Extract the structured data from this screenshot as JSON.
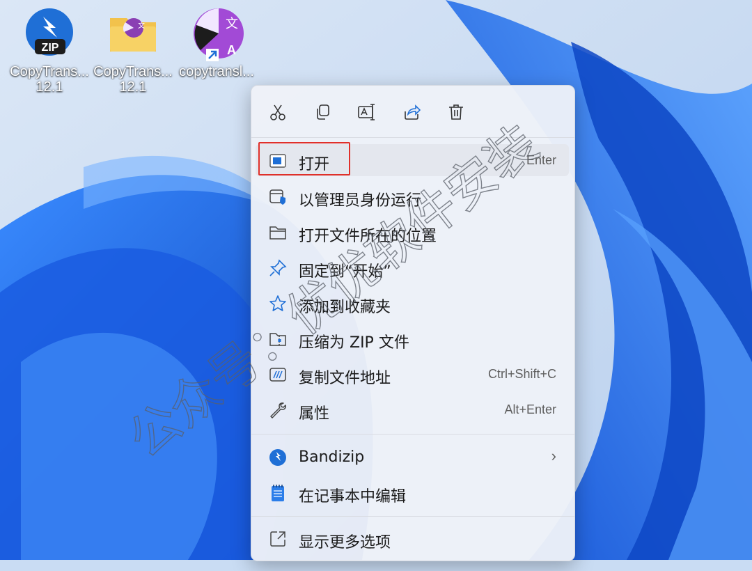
{
  "desktop": {
    "icons": [
      {
        "name": "CopyTrans...",
        "subtitle": "12.1",
        "type": "zip"
      },
      {
        "name": "CopyTrans...",
        "subtitle": "12.1",
        "type": "folder"
      },
      {
        "name": "copytransl...",
        "subtitle": "",
        "type": "shortcut"
      }
    ],
    "zip_badge": "ZIP",
    "translate_glyph": "文",
    "translate_letter": "A"
  },
  "context_menu": {
    "quick_actions": [
      {
        "icon": "cut-icon"
      },
      {
        "icon": "copy-icon"
      },
      {
        "icon": "rename-icon"
      },
      {
        "icon": "share-icon"
      },
      {
        "icon": "delete-icon"
      }
    ],
    "items": [
      {
        "label": "打开",
        "shortcut": "Enter",
        "icon": "open-app-icon"
      },
      {
        "label": "以管理员身份运行",
        "shortcut": "",
        "icon": "admin-shield-icon"
      },
      {
        "label": "打开文件所在的位置",
        "shortcut": "",
        "icon": "folder-icon"
      },
      {
        "label": "固定到“开始”",
        "shortcut": "",
        "icon": "pin-icon"
      },
      {
        "label": "添加到收藏夹",
        "shortcut": "",
        "icon": "star-icon"
      },
      {
        "label": "压缩为 ZIP 文件",
        "shortcut": "",
        "icon": "zip-folder-icon"
      },
      {
        "label": "复制文件地址",
        "shortcut": "Ctrl+Shift+C",
        "icon": "copy-path-icon"
      },
      {
        "label": "属性",
        "shortcut": "Alt+Enter",
        "icon": "wrench-icon"
      }
    ],
    "app_items": [
      {
        "label": "Bandizip",
        "icon": "bandizip-icon",
        "submenu": "›"
      },
      {
        "label": "在记事本中编辑",
        "icon": "notepad-icon"
      }
    ],
    "more_options": {
      "label": "显示更多选项",
      "icon": "more-options-icon"
    }
  },
  "watermark": "公众号：优优软件安装",
  "colors": {
    "accent_blue": "#1f6fd6",
    "highlight_red": "#e0302a",
    "menu_bg": "#eef1f8"
  }
}
